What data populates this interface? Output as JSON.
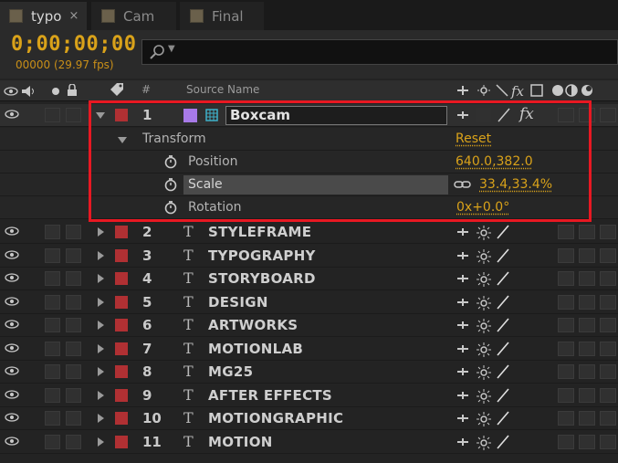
{
  "tabs": [
    {
      "label": "typo",
      "active": true,
      "close": "×"
    },
    {
      "label": "Cam",
      "active": false
    },
    {
      "label": "Final",
      "active": false
    }
  ],
  "timecode": "0;00;00;00",
  "fps": "00000 (29.97 fps)",
  "search": {
    "placeholder": ""
  },
  "columns": {
    "hash": "#",
    "source_name": "Source Name"
  },
  "layer1": {
    "number": "1",
    "name": "Boxcam",
    "label_color": "#a77ae8"
  },
  "transform": {
    "label": "Transform",
    "reset": "Reset",
    "position_label": "Position",
    "position_value": "640.0,382.0",
    "scale_label": "Scale",
    "scale_value": "33.4,33.4%",
    "rotation_label": "Rotation",
    "rotation_value": "0x+0.0°"
  },
  "layers": [
    {
      "number": "2",
      "name": "STYLEFRAME"
    },
    {
      "number": "3",
      "name": "TYPOGRAPHY"
    },
    {
      "number": "4",
      "name": "STORYBOARD"
    },
    {
      "number": "5",
      "name": "DESIGN"
    },
    {
      "number": "6",
      "name": "ARTWORKS"
    },
    {
      "number": "7",
      "name": "MOTIONLAB"
    },
    {
      "number": "8",
      "name": "MG25"
    },
    {
      "number": "9",
      "name": "AFTER EFFECTS"
    },
    {
      "number": "10",
      "name": "MOTIONGRAPHIC"
    },
    {
      "number": "11",
      "name": "MOTION"
    }
  ],
  "colors": {
    "accent": "#d9a21a",
    "label_red": "#b03033",
    "highlight": "#e81822"
  }
}
